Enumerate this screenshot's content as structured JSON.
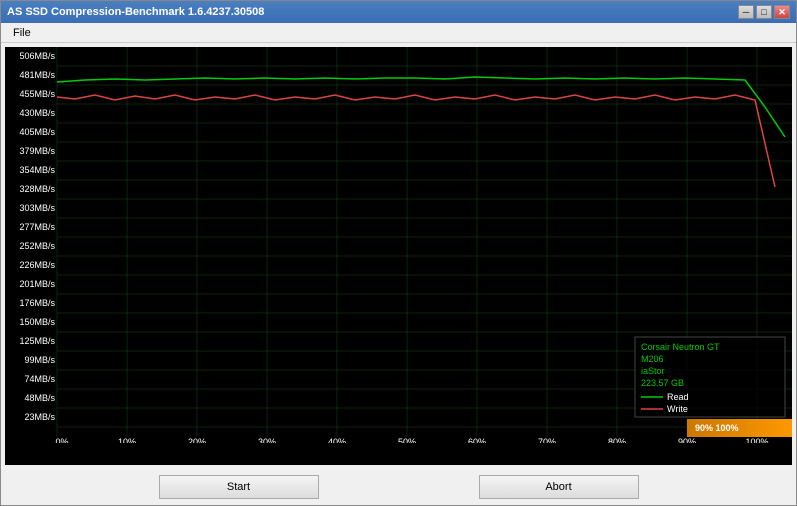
{
  "window": {
    "title": "AS SSD Compression-Benchmark 1.6.4237.30508",
    "min_btn": "─",
    "max_btn": "□",
    "close_btn": "✕"
  },
  "menu": {
    "file_label": "File"
  },
  "chart": {
    "y_labels": [
      "506MB/s",
      "481MB/s",
      "455MB/s",
      "430MB/s",
      "405MB/s",
      "379MB/s",
      "354MB/s",
      "328MB/s",
      "303MB/s",
      "277MB/s",
      "252MB/s",
      "226MB/s",
      "201MB/s",
      "176MB/s",
      "150MB/s",
      "125MB/s",
      "99MB/s",
      "74MB/s",
      "48MB/s",
      "23MB/s"
    ],
    "x_labels": [
      "0%",
      "10%",
      "20%",
      "30%",
      "40%",
      "50%",
      "60%",
      "70%",
      "80%",
      "90%",
      "100%"
    ],
    "read_color": "#00ff00",
    "write_color": "#ff4444",
    "grid_color": "#003300"
  },
  "legend": {
    "drive": "Corsair Neutron GT",
    "model": "M206",
    "driver": "iaStor",
    "size": "223.57 GB",
    "read_label": "Read",
    "write_label": "Write"
  },
  "highlight": {
    "text": "90% 100%"
  },
  "buttons": {
    "start_label": "Start",
    "abort_label": "Abort"
  }
}
